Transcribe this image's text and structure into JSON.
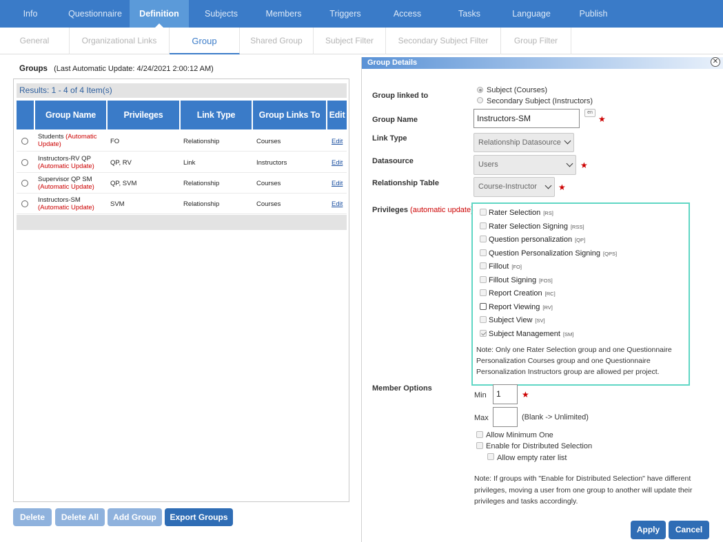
{
  "nav": {
    "tabs": [
      "Info",
      "Questionnaire",
      "Definition",
      "Subjects",
      "Members",
      "Triggers",
      "Access",
      "Tasks",
      "Language",
      "Publish"
    ],
    "active": "Definition"
  },
  "subnav": {
    "tabs": [
      "General",
      "Organizational Links",
      "Group",
      "Shared Group",
      "Subject Filter",
      "Secondary Subject Filter",
      "Group Filter"
    ],
    "active": "Group"
  },
  "groups": {
    "title": "Groups",
    "last_update": "(Last Automatic Update: 4/24/2021 2:00:12 AM)",
    "results": "Results: 1 - 4 of 4 Item(s)",
    "columns": [
      "Group Name",
      "Privileges",
      "Link Type",
      "Group Links To",
      "Edit"
    ],
    "rows": [
      {
        "name": "Students",
        "sub": "(Automatic Update)",
        "inline": true,
        "privileges": "FO",
        "link_type": "Relationship",
        "links_to": "Courses",
        "edit": "Edit"
      },
      {
        "name": "Instructors-RV QP",
        "sub": "(Automatic Update)",
        "inline": false,
        "privileges": "QP, RV",
        "link_type": "Link",
        "links_to": "Instructors",
        "edit": "Edit"
      },
      {
        "name": "Supervisor QP SM",
        "sub": "(Automatic Update)",
        "inline": false,
        "privileges": "QP, SVM",
        "link_type": "Relationship",
        "links_to": "Courses",
        "edit": "Edit"
      },
      {
        "name": "Instructors-SM",
        "sub": "(Automatic Update)",
        "inline": false,
        "privileges": "SVM",
        "link_type": "Relationship",
        "links_to": "Courses",
        "edit": "Edit"
      }
    ],
    "buttons": {
      "delete": "Delete",
      "delete_all": "Delete All",
      "add_group": "Add Group",
      "export_groups": "Export Groups"
    }
  },
  "details": {
    "title": "Group Details",
    "linked_to_label": "Group linked to",
    "linked_options": [
      "Subject (Courses)",
      "Secondary Subject (Instructors)"
    ],
    "group_name_label": "Group Name",
    "group_name_value": "Instructors-SM",
    "lang_badge": "en",
    "link_type_label": "Link Type",
    "link_type_value": "Relationship Datasource",
    "datasource_label": "Datasource",
    "datasource_value": "Users",
    "relationship_table_label": "Relationship Table",
    "relationship_table_value": "Course-Instructor",
    "privileges_label": "Privileges",
    "privileges_sub": "(automatic update)",
    "privileges": [
      {
        "label": "Rater Selection",
        "code": "[RS]",
        "checked": false
      },
      {
        "label": "Rater Selection Signing",
        "code": "[RSS]",
        "checked": false
      },
      {
        "label": "Question personalization",
        "code": "[QP]",
        "checked": false
      },
      {
        "label": "Question Personalization Signing",
        "code": "[QPS]",
        "checked": false
      },
      {
        "label": "Fillout",
        "code": "[FO]",
        "checked": false
      },
      {
        "label": "Fillout Signing",
        "code": "[FOS]",
        "checked": false
      },
      {
        "label": "Report Creation",
        "code": "[RC]",
        "checked": false
      },
      {
        "label": "Report Viewing",
        "code": "[RV]",
        "checked": false
      },
      {
        "label": "Subject View",
        "code": "[SV]",
        "checked": false
      },
      {
        "label": "Subject Management",
        "code": "[SM]",
        "checked": true
      }
    ],
    "priv_note": [
      "Note: Only one Rater Selection group and one Questionnaire",
      "Personalization Courses group and one Questionnaire",
      "Personalization Instructors group are allowed per project."
    ],
    "member_options_label": "Member Options",
    "min_label": "Min",
    "min_value": "1",
    "max_label": "Max",
    "max_value": "",
    "max_hint": "(Blank -> Unlimited)",
    "allow_min_one": "Allow Minimum One",
    "distributed": "Enable for Distributed Selection",
    "allow_empty": "Allow empty rater list",
    "dist_note": [
      "Note: If groups with \"Enable for Distributed Selection\" have different",
      "privileges, moving a user from one group to another will update their",
      "privileges and tasks accordingly."
    ],
    "apply": "Apply",
    "cancel": "Cancel"
  }
}
